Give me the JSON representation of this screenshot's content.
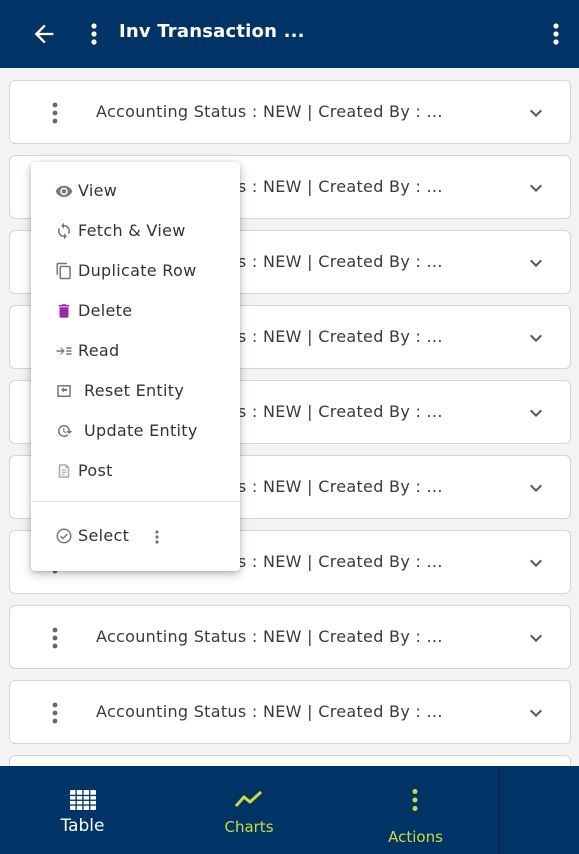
{
  "header": {
    "title": "Inv Transaction  ...",
    "background": "#003366"
  },
  "rows": [
    {
      "text": "Accounting Status  : NEW | Created By  : ..."
    },
    {
      "text": "Accounting Status  : NEW | Created By  : ..."
    },
    {
      "text": "Accounting Status  : NEW | Created By  : ..."
    },
    {
      "text": "Accounting Status  : NEW | Created By  : ..."
    },
    {
      "text": "Accounting Status  : NEW | Created By  : ..."
    },
    {
      "text": "Accounting Status  : NEW | Created By  : ..."
    },
    {
      "text": "Accounting Status  : NEW | Created By  : ..."
    },
    {
      "text": "Accounting Status  : NEW | Created By  : ..."
    },
    {
      "text": "Accounting Status  : NEW | Created By  : ..."
    }
  ],
  "context_menu": {
    "items": [
      {
        "label": "View",
        "icon": "eye-icon"
      },
      {
        "label": "Fetch & View",
        "icon": "refresh-icon"
      },
      {
        "label": "Duplicate Row",
        "icon": "copy-icon"
      },
      {
        "label": "Delete",
        "icon": "trash-icon",
        "icon_color": "#9c27b0"
      },
      {
        "label": "Read",
        "icon": "read-icon"
      },
      {
        "label": "Reset Entity",
        "icon": "reset-icon"
      },
      {
        "label": "Update Entity",
        "icon": "update-icon"
      },
      {
        "label": "Post",
        "icon": "post-icon"
      }
    ],
    "select_label": "Select"
  },
  "bottom_nav": {
    "tabs": [
      {
        "label": "Table",
        "icon": "table-icon",
        "color": "#ffffff"
      },
      {
        "label": "Charts",
        "icon": "chart-line-icon",
        "color": "#cddc39"
      },
      {
        "label": "Actions",
        "icon": "more-vertical-icon",
        "color": "#cddc39"
      }
    ]
  },
  "colors": {
    "primary": "#003366",
    "accent": "#cddc39",
    "delete": "#9c27b0"
  }
}
